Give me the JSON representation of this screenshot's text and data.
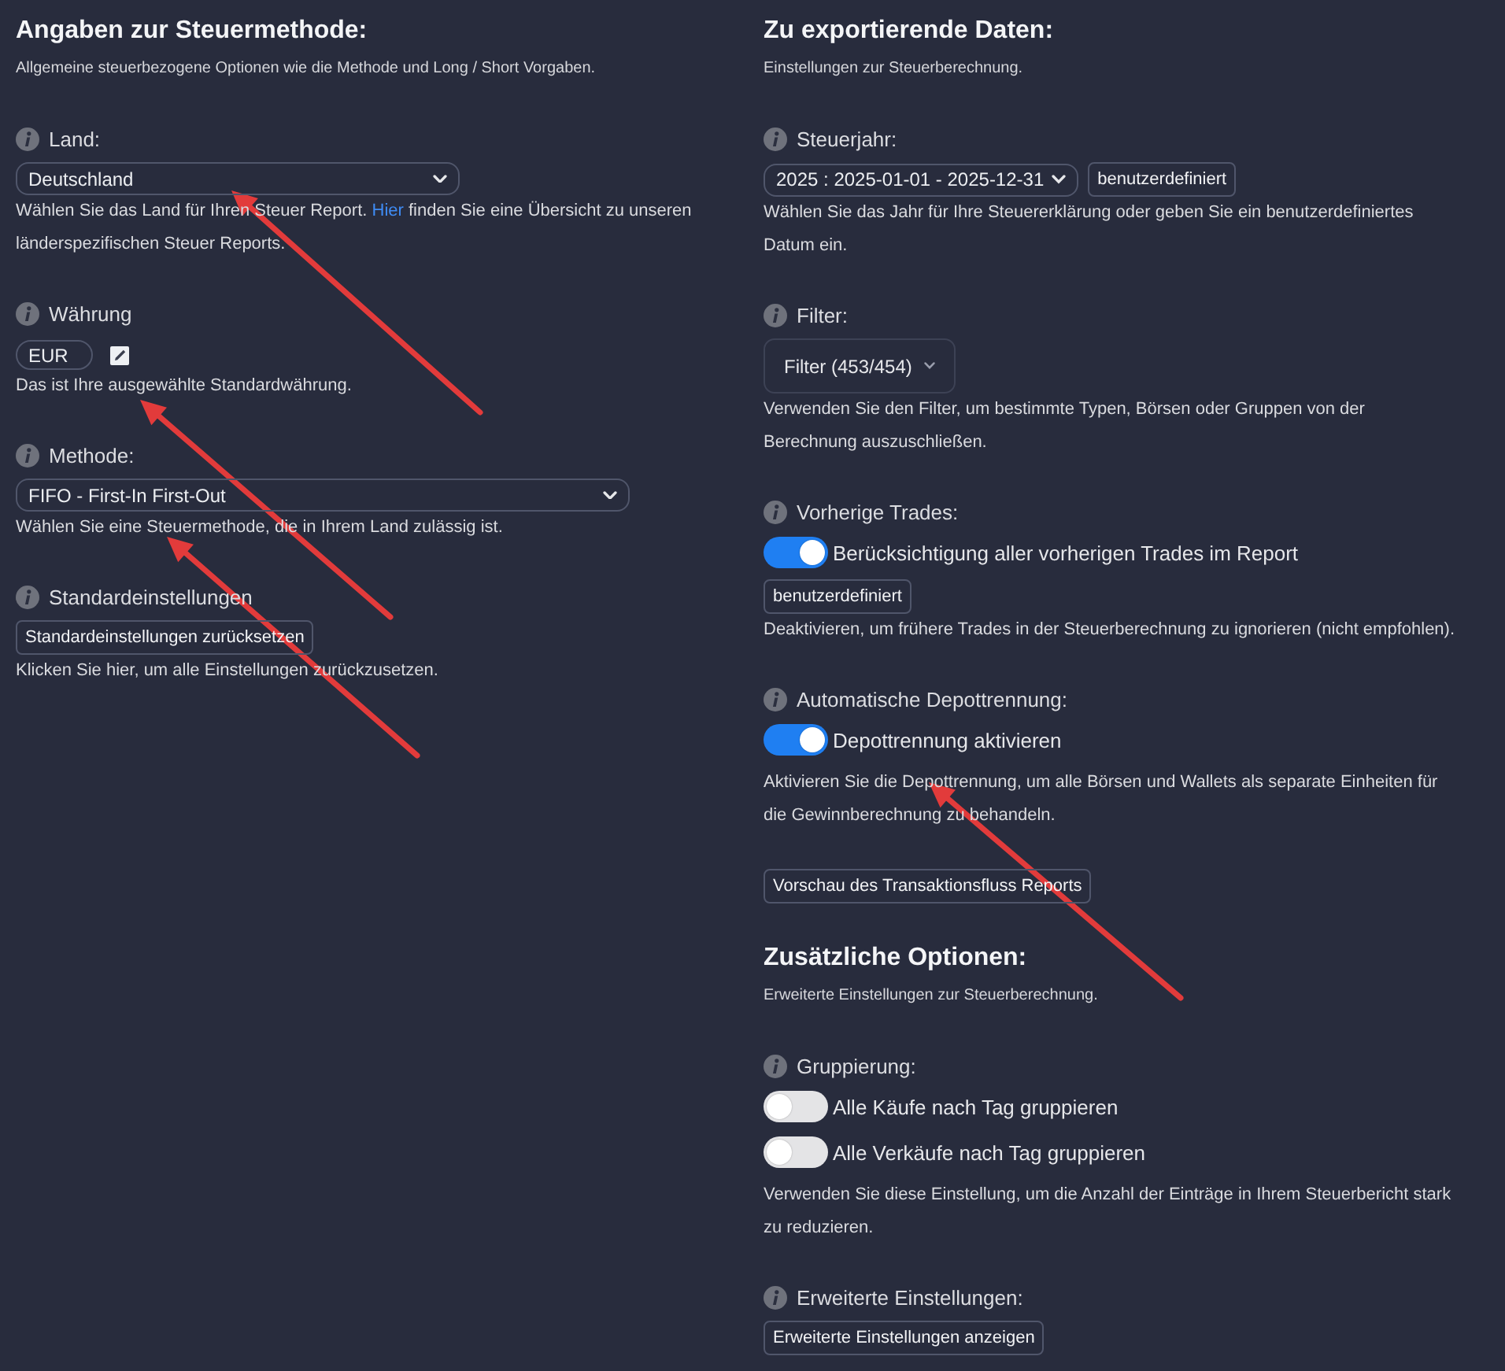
{
  "columns": [
    {
      "sections": [
        {
          "title": "Angaben zur Steuermethode:",
          "subtitle": "Allgemeine steuerbezogene Optionen wie die Methode und Long / Short Vorgaben.",
          "groups": [
            {
              "label": "Land:",
              "controls": [
                {
                  "kind": "select",
                  "value": "Deutschland"
                }
              ],
              "help": [
                {
                  "kind": "text",
                  "text": "Wählen Sie das Land für Ihren Steuer Report. "
                },
                {
                  "kind": "link",
                  "text": "Hier"
                },
                {
                  "kind": "text",
                  "text": " finden Sie eine Übersicht zu unseren länderspezifischen Steuer Reports."
                }
              ]
            },
            {
              "label": "Währung",
              "controls": [
                {
                  "kind": "currency",
                  "value": "EUR"
                }
              ],
              "help": "Das ist Ihre ausgewählte Standardwährung."
            },
            {
              "label": "Methode:",
              "controls": [
                {
                  "kind": "select",
                  "value": "FIFO - First-In First-Out"
                }
              ],
              "help": "Wählen Sie eine Steuermethode, die in Ihrem Land zulässig ist."
            },
            {
              "label": "Standardeinstellungen",
              "controls": [
                {
                  "kind": "button",
                  "label": "Standardeinstellungen zurücksetzen"
                }
              ],
              "help": "Klicken Sie hier, um alle Einstellungen zurückzusetzen."
            }
          ]
        }
      ]
    },
    {
      "sections": [
        {
          "title": "Zu exportierende Daten:",
          "subtitle": "Einstellungen zur Steuerberechnung.",
          "groups": [
            {
              "label": "Steuerjahr:",
              "controls": [
                {
                  "kind": "select",
                  "value": "2025 : 2025-01-01 - 2025-12-31",
                  "action": "benutzerdefiniert"
                }
              ],
              "help": "Wählen Sie das Jahr für Ihre Steuererklärung oder geben Sie ein benutzerdefiniertes Datum ein."
            },
            {
              "label": "Filter:",
              "controls": [
                {
                  "kind": "dropdown",
                  "label": "Filter (453/454)"
                }
              ],
              "help": "Verwenden Sie den Filter, um bestimmte Typen, Börsen oder Gruppen von der Berechnung auszuschließen."
            },
            {
              "label": "Vorherige Trades:",
              "controls": [
                {
                  "kind": "toggle",
                  "on": true,
                  "label": "Berücksichtigung aller vorherigen Trades im Report"
                },
                {
                  "kind": "button",
                  "label": "benutzerdefiniert"
                }
              ],
              "help": "Deaktivieren, um frühere Trades in der Steuerberechnung zu ignorieren (nicht empfohlen)."
            },
            {
              "label": "Automatische Depottrennung:",
              "controls": [
                {
                  "kind": "toggle",
                  "on": true,
                  "label": "Depottrennung aktivieren"
                }
              ],
              "help": "Aktivieren Sie die Depottrennung, um alle Börsen und Wallets als separate Einheiten für die Gewinnberechnung zu behandeln."
            },
            {
              "controls": [
                {
                  "kind": "button",
                  "label": "Vorschau des Transaktionsfluss Reports"
                }
              ]
            }
          ]
        },
        {
          "title": "Zusätzliche Optionen:",
          "subtitle": "Erweiterte Einstellungen zur Steuerberechnung.",
          "groups": [
            {
              "label": "Gruppierung:",
              "controls": [
                {
                  "kind": "toggle",
                  "on": false,
                  "label": "Alle Käufe nach Tag gruppieren"
                },
                {
                  "kind": "toggle",
                  "on": false,
                  "label": "Alle Verkäufe nach Tag gruppieren"
                }
              ],
              "help": "Verwenden Sie diese Einstellung, um die Anzahl der Einträge in Ihrem Steuerbericht stark zu reduzieren."
            },
            {
              "label": "Erweiterte Einstellungen:",
              "controls": [
                {
                  "kind": "button",
                  "label": "Erweiterte Einstellungen anzeigen"
                }
              ]
            }
          ]
        }
      ]
    }
  ],
  "annotations": [
    {
      "kind": "arrow"
    },
    {
      "kind": "arrow"
    },
    {
      "kind": "arrow"
    },
    {
      "kind": "arrow"
    }
  ]
}
